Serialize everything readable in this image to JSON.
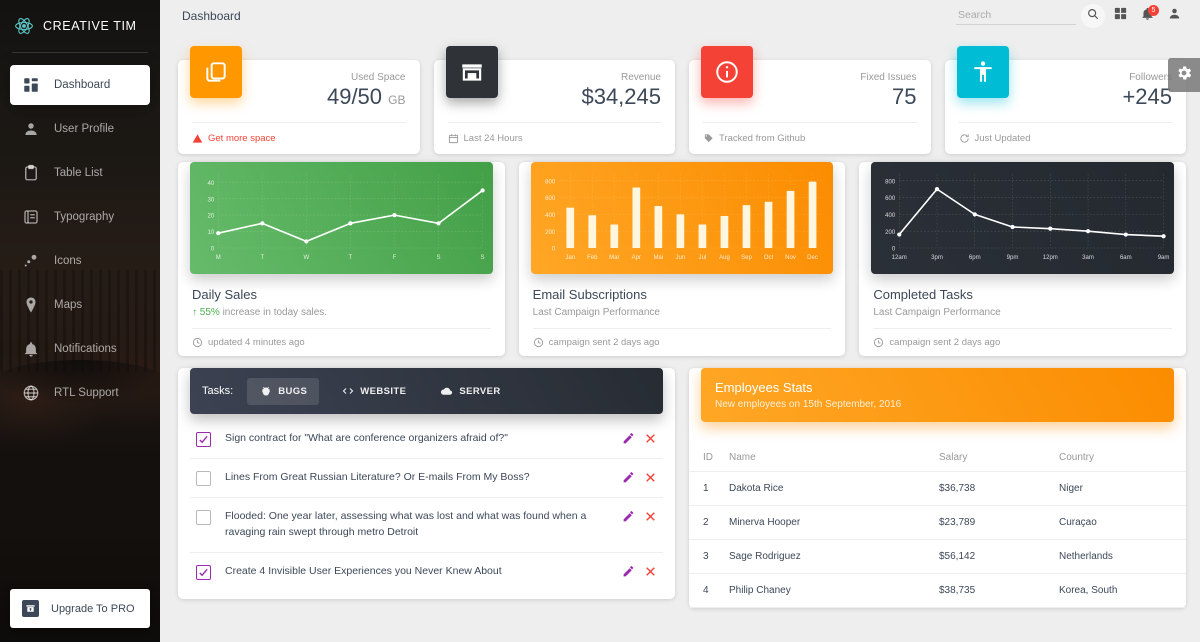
{
  "sidebar": {
    "brand": {
      "text": "CREATIVE TIM",
      "icon": "atom-icon"
    },
    "items": [
      {
        "label": "Dashboard",
        "icon": "dashboard-grid-icon",
        "active": true
      },
      {
        "label": "User Profile",
        "icon": "person-icon",
        "active": false
      },
      {
        "label": "Table List",
        "icon": "clipboard-icon",
        "active": false
      },
      {
        "label": "Typography",
        "icon": "typography-icon",
        "active": false
      },
      {
        "label": "Icons",
        "icon": "bubbles-icon",
        "active": false
      },
      {
        "label": "Maps",
        "icon": "location-pin-icon",
        "active": false
      },
      {
        "label": "Notifications",
        "icon": "bell-icon",
        "active": false
      },
      {
        "label": "RTL Support",
        "icon": "globe-icon",
        "active": false
      }
    ],
    "upgrade": {
      "label": "Upgrade To PRO",
      "icon": "unarchive-icon"
    }
  },
  "topbar": {
    "title": "Dashboard",
    "search": {
      "placeholder": "Search",
      "value": ""
    },
    "icons": {
      "search": "search-icon",
      "dashboard": "dashboard-grid-icon",
      "notifications": "bell-icon",
      "person": "person-icon"
    },
    "notification_badge": "5"
  },
  "floating": {
    "gear": "gear-icon"
  },
  "stats": [
    {
      "icon": "content-copy-icon",
      "color": "#ff9800",
      "label": "Used Space",
      "value": "49/50",
      "unit": "GB",
      "footer": "Get more space",
      "footer_icon": "warning-icon",
      "footer_danger": true
    },
    {
      "icon": "store-icon",
      "color": "#2f3237",
      "label": "Revenue",
      "value": "$34,245",
      "unit": "",
      "footer": "Last 24 Hours",
      "footer_icon": "calendar-icon",
      "footer_danger": false
    },
    {
      "icon": "info-outline-icon",
      "color": "#f44336",
      "label": "Fixed Issues",
      "value": "75",
      "unit": "",
      "footer": "Tracked from Github",
      "footer_icon": "tag-icon",
      "footer_danger": false
    },
    {
      "icon": "accessibility-icon",
      "color": "#00bcd4",
      "label": "Followers",
      "value": "+245",
      "unit": "",
      "footer": "Just Updated",
      "footer_icon": "update-icon",
      "footer_danger": false
    }
  ],
  "chart_data": [
    {
      "type": "line",
      "title": "Daily Sales",
      "subtitle_prefix": "55%",
      "subtitle": " increase in today sales.",
      "footer": "updated 4 minutes ago",
      "footer_icon": "clock-icon",
      "theme": "green",
      "categories": [
        "M",
        "T",
        "W",
        "T",
        "F",
        "S",
        "S"
      ],
      "values": [
        9,
        15,
        4,
        15,
        20,
        15,
        35
      ],
      "ticks": [
        0,
        10,
        20,
        30,
        40
      ],
      "ylim": [
        0,
        45
      ],
      "xlabel": "",
      "ylabel": "",
      "grid": true,
      "legend": "none"
    },
    {
      "type": "bar",
      "title": "Email Subscriptions",
      "subtitle": "Last Campaign Performance",
      "footer": "campaign sent 2 days ago",
      "footer_icon": "clock-icon",
      "theme": "orange",
      "categories": [
        "Jan",
        "Feb",
        "Mar",
        "Apr",
        "Mai",
        "Jun",
        "Jul",
        "Aug",
        "Sep",
        "Oct",
        "Nov",
        "Dec"
      ],
      "values": [
        480,
        390,
        280,
        720,
        500,
        400,
        280,
        380,
        510,
        550,
        680,
        790
      ],
      "ticks": [
        0,
        200,
        400,
        600,
        800
      ],
      "ylim": [
        0,
        880
      ],
      "xlabel": "",
      "ylabel": "",
      "grid": true,
      "legend": "none"
    },
    {
      "type": "line",
      "title": "Completed Tasks",
      "subtitle": "Last Campaign Performance",
      "footer": "campaign sent 2 days ago",
      "footer_icon": "clock-icon",
      "theme": "dark",
      "categories": [
        "12am",
        "3pm",
        "6pm",
        "9pm",
        "12pm",
        "3am",
        "6am",
        "9am"
      ],
      "values": [
        160,
        700,
        400,
        250,
        230,
        200,
        160,
        140
      ],
      "ticks": [
        0,
        200,
        400,
        600,
        800
      ],
      "ylim": [
        0,
        880
      ],
      "xlabel": "",
      "ylabel": "",
      "grid": true,
      "legend": "none"
    }
  ],
  "tasks": {
    "label": "Tasks:",
    "tabs": [
      {
        "label": "BUGS",
        "icon": "bug-icon",
        "active": true
      },
      {
        "label": "WEBSITE",
        "icon": "code-icon",
        "active": false
      },
      {
        "label": "SERVER",
        "icon": "cloud-icon",
        "active": false
      }
    ],
    "items": [
      {
        "checked": true,
        "text": "Sign contract for \"What are conference organizers afraid of?\""
      },
      {
        "checked": false,
        "text": "Lines From Great Russian Literature? Or E-mails From My Boss?"
      },
      {
        "checked": false,
        "text": "Flooded: One year later, assessing what was lost and what was found when a ravaging rain swept through metro Detroit"
      },
      {
        "checked": true,
        "text": "Create 4 Invisible User Experiences you Never Knew About"
      }
    ],
    "edit_icon": "pencil-icon",
    "delete_icon": "close-icon"
  },
  "employees": {
    "title": "Employees Stats",
    "subtitle": "New employees on 15th September, 2016",
    "columns": [
      "ID",
      "Name",
      "Salary",
      "Country"
    ],
    "rows": [
      {
        "id": "1",
        "name": "Dakota Rice",
        "salary": "$36,738",
        "country": "Niger"
      },
      {
        "id": "2",
        "name": "Minerva Hooper",
        "salary": "$23,789",
        "country": "Curaçao"
      },
      {
        "id": "3",
        "name": "Sage Rodriguez",
        "salary": "$56,142",
        "country": "Netherlands"
      },
      {
        "id": "4",
        "name": "Philip Chaney",
        "salary": "$38,735",
        "country": "Korea, South"
      }
    ]
  }
}
